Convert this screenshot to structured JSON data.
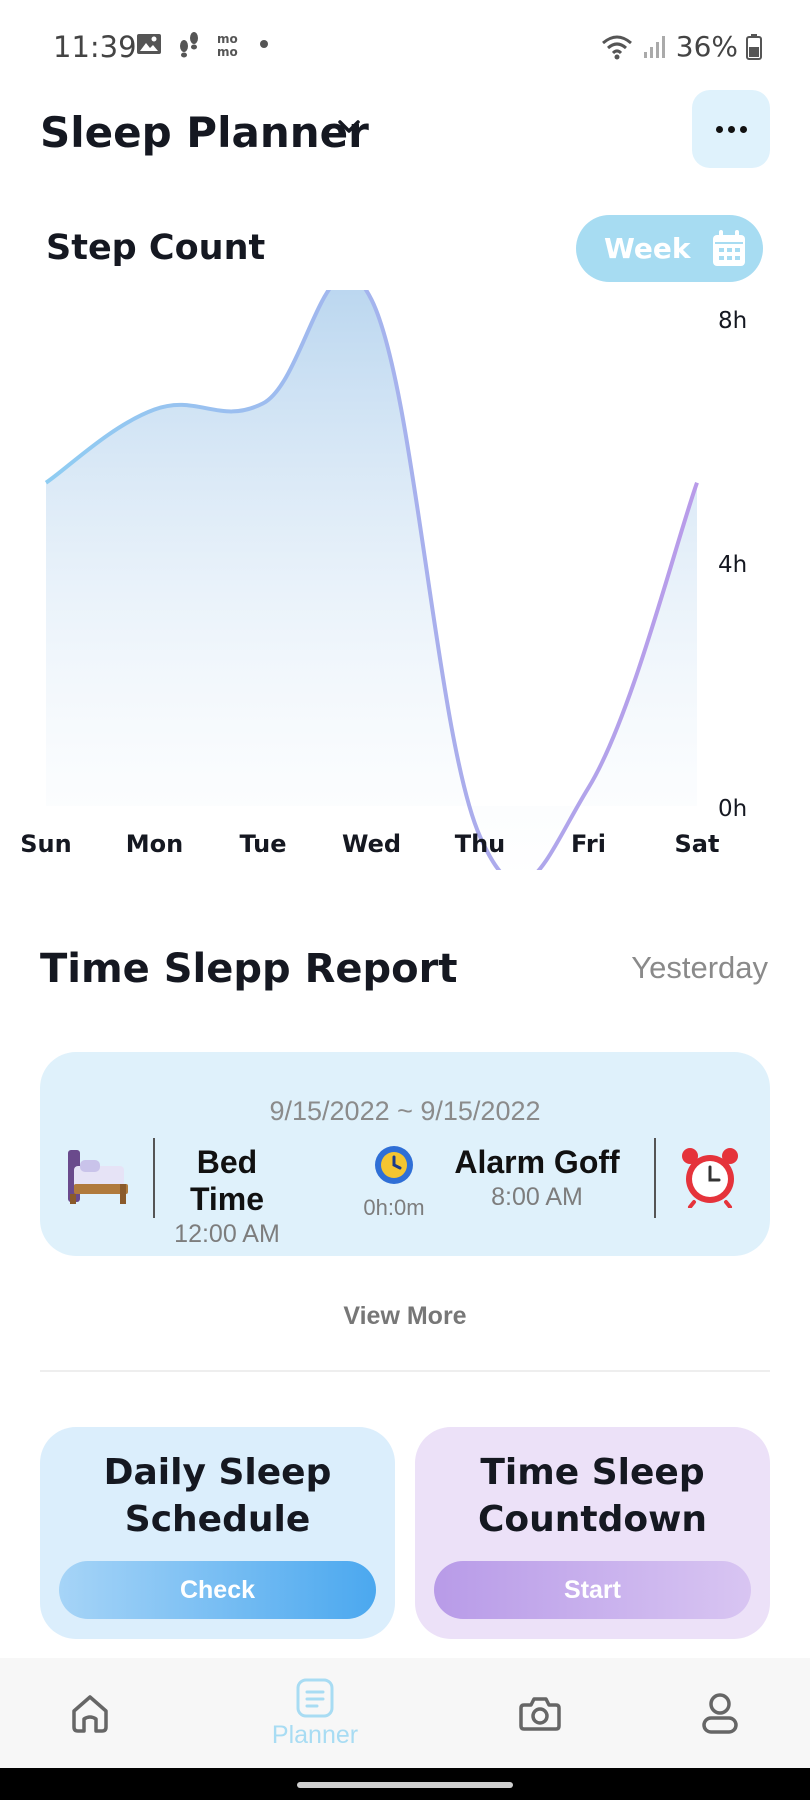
{
  "status_bar": {
    "time": "11:39",
    "battery": "36%",
    "left_icons": [
      "gallery-icon",
      "footsteps-icon",
      "momo-icon",
      "dot-icon"
    ],
    "right_icons": [
      "wifi-icon",
      "signal-icon",
      "battery-icon"
    ]
  },
  "header": {
    "title": "Sleep Planner",
    "chevron_icon": "chevron-down-icon",
    "more_icon": "more-horizontal-icon"
  },
  "chart_section": {
    "title": "Step Count",
    "period_label": "Week",
    "period_icon": "calendar-icon"
  },
  "chart_data": {
    "type": "area",
    "categories": [
      "Sun",
      "Mon",
      "Tue",
      "Wed",
      "Thu",
      "Fri",
      "Sat"
    ],
    "values": [
      5.3,
      6.5,
      6.6,
      8.3,
      -0.5,
      0.3,
      5.3
    ],
    "ylabel": "",
    "y_ticks": [
      "0h",
      "4h",
      "8h"
    ],
    "ylim": [
      0,
      8
    ],
    "grid": false,
    "line_gradient": [
      "#8fcdf2",
      "#b99be9"
    ],
    "fill_color": "#bcd8ef"
  },
  "report": {
    "title": "Time Slepp Report",
    "period": "Yesterday",
    "date_range": "9/15/2022 ~ 9/15/2022",
    "bed_label": "Bed Time",
    "bed_time": "12:00 AM",
    "duration": "0h:0m",
    "alarm_label": "Alarm Goff",
    "alarm_time": "8:00 AM",
    "bed_icon": "bed-icon",
    "duration_icon": "clock-icon",
    "alarm_icon": "alarm-clock-icon",
    "view_more": "View More"
  },
  "cards": {
    "daily": {
      "title_line1": "Daily Sleep",
      "title_line2": "Schedule",
      "button": "Check"
    },
    "countdown": {
      "title_line1": "Time Sleep",
      "title_line2": "Countdown",
      "button": "Start"
    }
  },
  "bottom_nav": {
    "items": [
      {
        "icon": "home-icon",
        "label": ""
      },
      {
        "icon": "planner-icon",
        "label": "Planner"
      },
      {
        "icon": "camera-icon",
        "label": ""
      },
      {
        "icon": "profile-icon",
        "label": ""
      }
    ],
    "active_color": "#a8dcf3",
    "inactive_color": "#666666"
  }
}
